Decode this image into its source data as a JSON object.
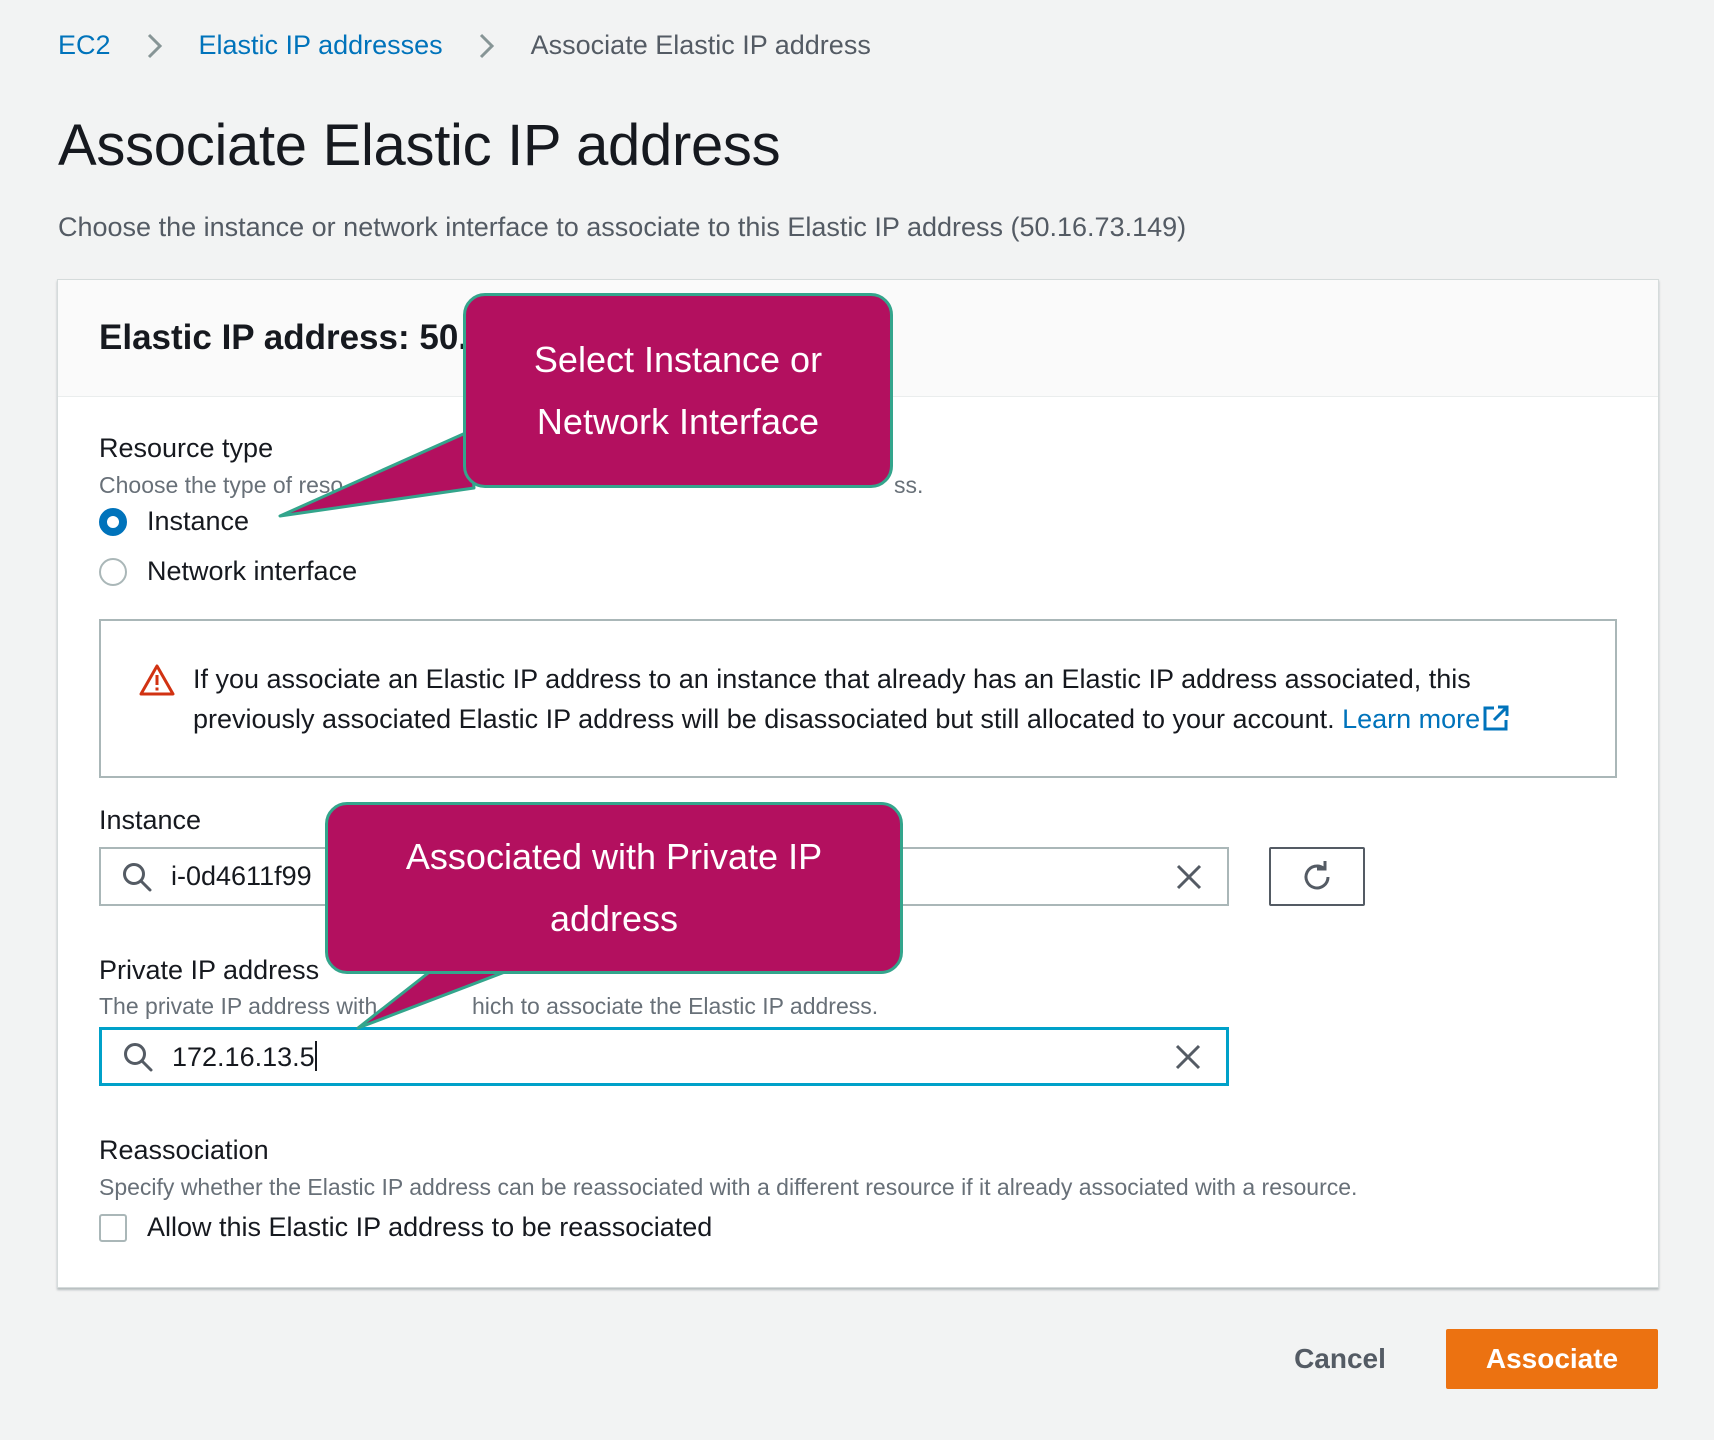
{
  "breadcrumb": {
    "items": [
      "EC2",
      "Elastic IP addresses"
    ],
    "current": "Associate Elastic IP address"
  },
  "page": {
    "title": "Associate Elastic IP address",
    "description": "Choose the instance or network interface to associate to this Elastic IP address (50.16.73.149)"
  },
  "panel": {
    "title": "Elastic IP address: 50."
  },
  "resource_type": {
    "label": "Resource type",
    "description": "Choose the type of reso",
    "description_tail": "ss.",
    "options": [
      {
        "label": "Instance",
        "checked": true
      },
      {
        "label": "Network interface",
        "checked": false
      }
    ]
  },
  "alert": {
    "text": "If you associate an Elastic IP address to an instance that already has an Elastic IP address associated, this previously associated Elastic IP address will be disassociated but still allocated to your account.",
    "link": "Learn more",
    "icon": "warning-icon",
    "color": "#d13212"
  },
  "instance": {
    "label": "Instance",
    "value": "i-0d4611f99"
  },
  "private_ip": {
    "label": "Private IP address",
    "description": "The private IP address with",
    "description_tail": "hich to associate the Elastic IP address.",
    "value": "172.16.13.5"
  },
  "reassociation": {
    "label": "Reassociation",
    "description": "Specify whether the Elastic IP address can be reassociated with a different resource if it already associated with a resource.",
    "checkbox_label": "Allow this Elastic IP address to be reassociated",
    "checked": false
  },
  "footer": {
    "cancel": "Cancel",
    "associate": "Associate"
  },
  "callouts": {
    "resource": {
      "line1": "Select Instance or",
      "line2": "Network Interface"
    },
    "private_ip": {
      "line1": "Associated with Private IP",
      "line2": "address"
    }
  },
  "colors": {
    "link": "#0073bb",
    "primary_button": "#ec7211",
    "callout_fill": "#b3105f",
    "callout_border": "#33a58c",
    "focus": "#00a1c9"
  }
}
